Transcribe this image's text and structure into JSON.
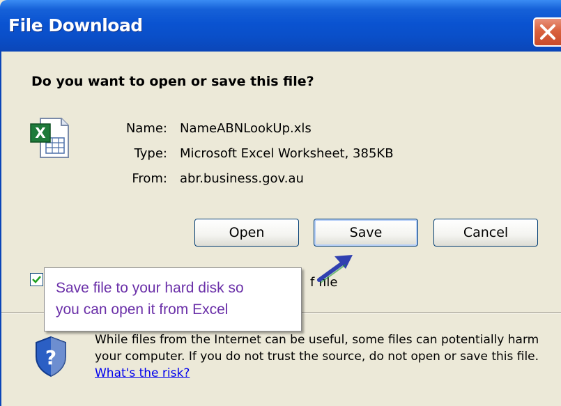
{
  "window": {
    "title": "File Download"
  },
  "dialog": {
    "question": "Do you want to open or save this file?",
    "file": {
      "name_label": "Name:",
      "name_value": "NameABNLookUp.xls",
      "type_label": "Type:",
      "type_value": "Microsoft Excel Worksheet, 385KB",
      "from_label": "From:",
      "from_value": "abr.business.gov.au",
      "icon": "excel-file-icon"
    },
    "buttons": {
      "open": "Open",
      "save": "Save",
      "cancel": "Cancel"
    },
    "checkbox": {
      "checked": true,
      "label_fragment": "f file"
    },
    "warning": {
      "text": "While files from the Internet can be useful, some files can potentially harm your computer. If you do not trust the source, do not open or save this file.",
      "link": "What's the risk?"
    }
  },
  "callout": {
    "line1": "Save file to your hard disk so",
    "line2": "you can open it from Excel",
    "color": "#6a2fa8"
  },
  "colors": {
    "titlebar": "#0a53d1",
    "dialog_bg": "#ece9d8",
    "link": "#0000ee"
  }
}
